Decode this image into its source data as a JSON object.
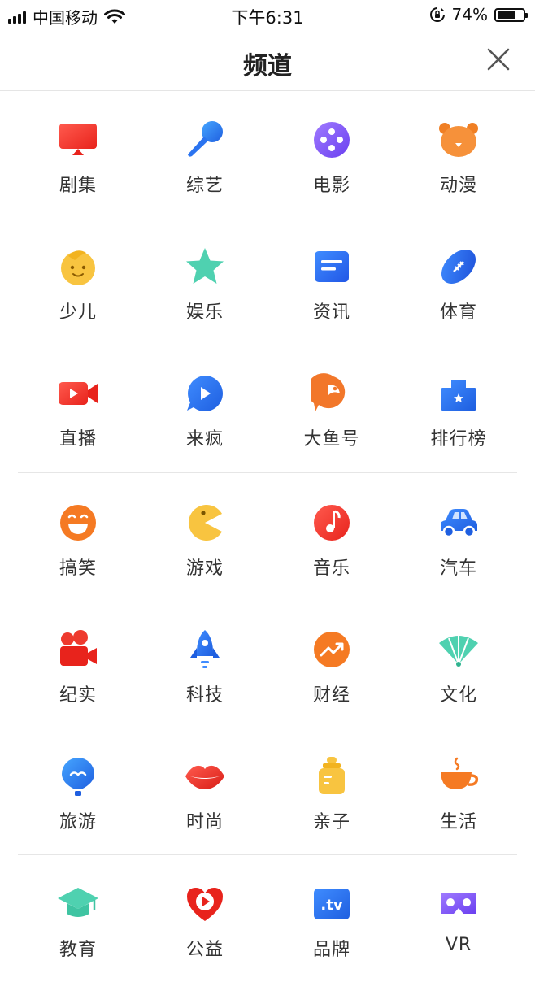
{
  "status_bar": {
    "carrier": "中国移动",
    "time": "下午6:31",
    "battery": "74%",
    "battery_level": 0.74
  },
  "header": {
    "title": "频道"
  },
  "sections": [
    {
      "items": [
        {
          "label": "剧集",
          "icon": "tv-icon"
        },
        {
          "label": "综艺",
          "icon": "microphone-icon"
        },
        {
          "label": "电影",
          "icon": "film-reel-icon"
        },
        {
          "label": "动漫",
          "icon": "bear-icon"
        },
        {
          "label": "少儿",
          "icon": "child-face-icon"
        },
        {
          "label": "娱乐",
          "icon": "star-icon"
        },
        {
          "label": "资讯",
          "icon": "news-icon"
        },
        {
          "label": "体育",
          "icon": "football-icon"
        },
        {
          "label": "直播",
          "icon": "video-camera-icon"
        },
        {
          "label": "来疯",
          "icon": "play-bubble-icon"
        },
        {
          "label": "大鱼号",
          "icon": "fish-icon"
        },
        {
          "label": "排行榜",
          "icon": "podium-icon"
        }
      ]
    },
    {
      "items": [
        {
          "label": "搞笑",
          "icon": "laugh-icon"
        },
        {
          "label": "游戏",
          "icon": "pacman-icon"
        },
        {
          "label": "音乐",
          "icon": "music-note-icon"
        },
        {
          "label": "汽车",
          "icon": "car-icon"
        },
        {
          "label": "纪实",
          "icon": "movie-camera-icon"
        },
        {
          "label": "科技",
          "icon": "rocket-icon"
        },
        {
          "label": "财经",
          "icon": "trend-up-icon"
        },
        {
          "label": "文化",
          "icon": "fan-icon"
        },
        {
          "label": "旅游",
          "icon": "balloon-icon"
        },
        {
          "label": "时尚",
          "icon": "lips-icon"
        },
        {
          "label": "亲子",
          "icon": "baby-bottle-icon"
        },
        {
          "label": "生活",
          "icon": "coffee-cup-icon"
        }
      ]
    },
    {
      "items": [
        {
          "label": "教育",
          "icon": "graduation-cap-icon"
        },
        {
          "label": "公益",
          "icon": "heart-play-icon"
        },
        {
          "label": "品牌",
          "icon": "tv-badge-icon",
          "badge": ".tv"
        },
        {
          "label": "VR",
          "icon": "vr-goggles-icon"
        }
      ]
    }
  ]
}
